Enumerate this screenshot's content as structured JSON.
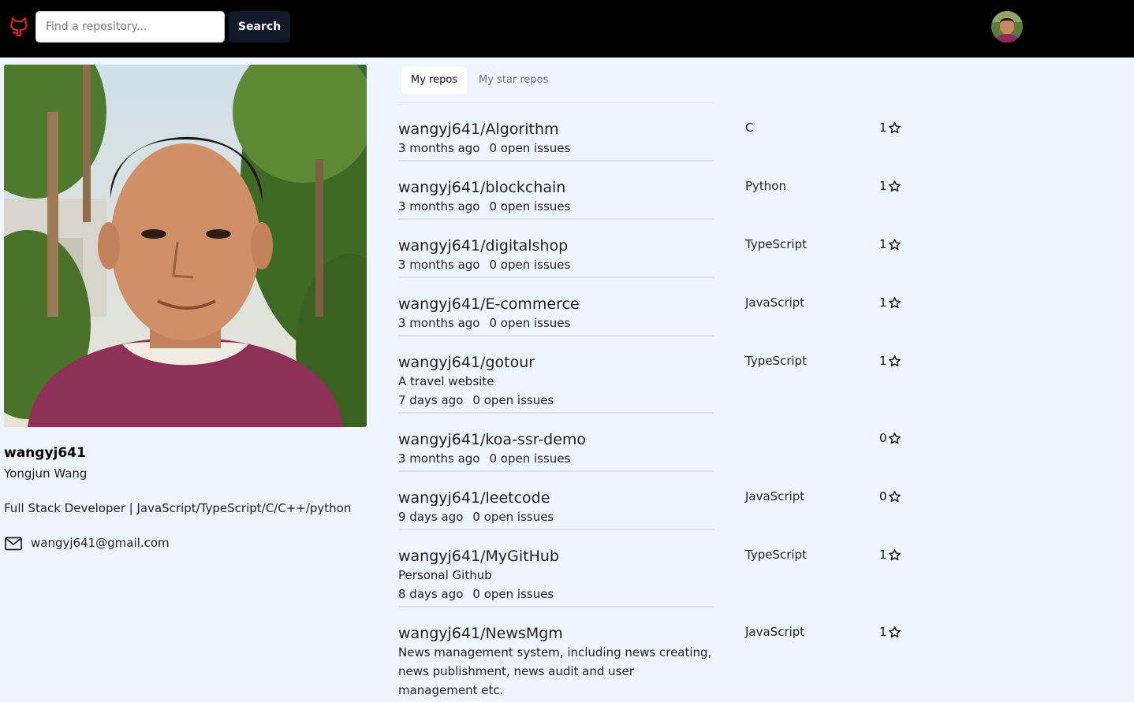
{
  "header": {
    "search_placeholder": "Find a repository...",
    "search_button": "Search"
  },
  "profile": {
    "login": "wangyj641",
    "name": "Yongjun Wang",
    "bio": "Full Stack Developer | JavaScript/TypeScript/C/C++/python",
    "email": "wangyj641@gmail.com"
  },
  "tabs": [
    {
      "label": "My repos",
      "active": true
    },
    {
      "label": "My star repos",
      "active": false
    }
  ],
  "repos": [
    {
      "name": "wangyj641/Algorithm",
      "description": "",
      "updated": "3 months ago",
      "issues": "0 open issues",
      "language": "C",
      "stars": "1"
    },
    {
      "name": "wangyj641/blockchain",
      "description": "",
      "updated": "3 months ago",
      "issues": "0 open issues",
      "language": "Python",
      "stars": "1"
    },
    {
      "name": "wangyj641/digitalshop",
      "description": "",
      "updated": "3 months ago",
      "issues": "0 open issues",
      "language": "TypeScript",
      "stars": "1"
    },
    {
      "name": "wangyj641/E-commerce",
      "description": "",
      "updated": "3 months ago",
      "issues": "0 open issues",
      "language": "JavaScript",
      "stars": "1"
    },
    {
      "name": "wangyj641/gotour",
      "description": "A travel website",
      "updated": "7 days ago",
      "issues": "0 open issues",
      "language": "TypeScript",
      "stars": "1"
    },
    {
      "name": "wangyj641/koa-ssr-demo",
      "description": "",
      "updated": "3 months ago",
      "issues": "0 open issues",
      "language": "",
      "stars": "0"
    },
    {
      "name": "wangyj641/leetcode",
      "description": "",
      "updated": "9 days ago",
      "issues": "0 open issues",
      "language": "JavaScript",
      "stars": "0"
    },
    {
      "name": "wangyj641/MyGitHub",
      "description": "Personal Github",
      "updated": "8 days ago",
      "issues": "0 open issues",
      "language": "TypeScript",
      "stars": "1"
    },
    {
      "name": "wangyj641/NewsMgm",
      "description": "News management system, including news creating, news publishment, news audit and user management etc.",
      "updated": "",
      "issues": "",
      "language": "JavaScript",
      "stars": "1"
    }
  ]
}
